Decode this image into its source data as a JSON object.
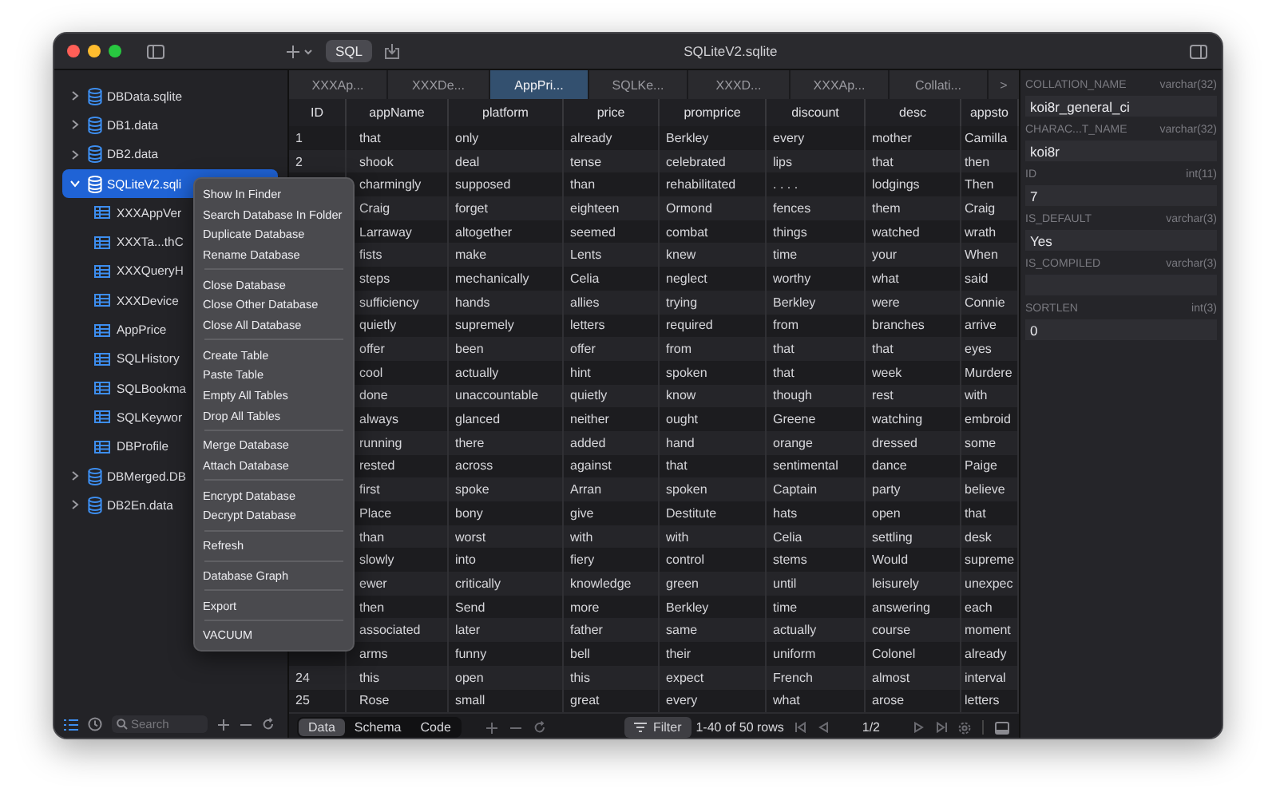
{
  "window": {
    "title": "SQLiteV2.sqlite"
  },
  "toolbar": {
    "sql_button": "SQL"
  },
  "sidebar": {
    "items": [
      {
        "name": "DBData.sqlite",
        "kind": "database",
        "expanded": false,
        "selected": false
      },
      {
        "name": "DB1.data",
        "kind": "database",
        "expanded": false,
        "selected": false
      },
      {
        "name": "DB2.data",
        "kind": "database",
        "expanded": false,
        "selected": false
      },
      {
        "name": "SQLiteV2.sqli",
        "kind": "database",
        "expanded": true,
        "selected": true,
        "children": [
          {
            "name": "XXXAppVer",
            "kind": "table",
            "selected": false
          },
          {
            "name": "XXXTa...thC",
            "kind": "table",
            "selected": false
          },
          {
            "name": "XXXQueryH",
            "kind": "table",
            "selected": false
          },
          {
            "name": "XXXDevice",
            "kind": "table",
            "selected": false
          },
          {
            "name": "AppPrice",
            "kind": "table",
            "selected": false
          },
          {
            "name": "SQLHistory",
            "kind": "table",
            "selected": false
          },
          {
            "name": "SQLBookma",
            "kind": "table",
            "selected": false
          },
          {
            "name": "SQLKeywor",
            "kind": "table",
            "selected": false
          },
          {
            "name": "DBProfile",
            "kind": "table",
            "selected": false
          }
        ]
      },
      {
        "name": "DBMerged.DB",
        "kind": "database",
        "expanded": false,
        "selected": false
      },
      {
        "name": "DB2En.data",
        "kind": "database",
        "expanded": false,
        "selected": false
      }
    ],
    "search": {
      "placeholder": "Search"
    }
  },
  "context_menu": [
    [
      "Show In Finder",
      "Search Database In Folder",
      "Duplicate Database",
      "Rename Database"
    ],
    [
      "Close Database",
      "Close Other Database",
      "Close All Database"
    ],
    [
      "Create Table",
      "Paste Table",
      "Empty All Tables",
      "Drop All Tables"
    ],
    [
      "Merge Database",
      "Attach Database"
    ],
    [
      "Encrypt Database",
      "Decrypt Database"
    ],
    [
      "Refresh"
    ],
    [
      "Database Graph"
    ],
    [
      "Export"
    ],
    [
      "VACUUM"
    ]
  ],
  "tabs": [
    {
      "label": "XXXAp...",
      "selected": false
    },
    {
      "label": "XXXDe...",
      "selected": false
    },
    {
      "label": "AppPri...",
      "selected": true
    },
    {
      "label": "SQLKe...",
      "selected": false
    },
    {
      "label": "XXXD...",
      "selected": false
    },
    {
      "label": "XXXAp...",
      "selected": false
    },
    {
      "label": "Collati...",
      "selected": false
    }
  ],
  "tabs_more": ">",
  "table": {
    "columns": [
      "ID",
      "appName",
      "platform",
      "price",
      "promprice",
      "discount",
      "desc",
      "appsto"
    ],
    "rows": [
      [
        "1",
        "that",
        "only",
        "already",
        "Berkley",
        "every",
        "mother",
        "Camilla"
      ],
      [
        "2",
        "shook",
        "deal",
        "tense",
        "celebrated",
        "lips",
        "that",
        "then"
      ],
      [
        "",
        "charmingly",
        "supposed",
        "than",
        "rehabilitated",
        ". . . .",
        "lodgings",
        "Then"
      ],
      [
        "",
        "Craig",
        "forget",
        "eighteen",
        "Ormond",
        "fences",
        "them",
        "Craig"
      ],
      [
        "",
        "Larraway",
        "altogether",
        "seemed",
        "combat",
        "things",
        "watched",
        "wrath"
      ],
      [
        "",
        "fists",
        "make",
        "Lents",
        "knew",
        "time",
        "your",
        "When"
      ],
      [
        "",
        "steps",
        "mechanically",
        "Celia",
        "neglect",
        "worthy",
        "what",
        "said"
      ],
      [
        "",
        "sufficiency",
        "hands",
        "allies",
        "trying",
        "Berkley",
        "were",
        "Connie"
      ],
      [
        "",
        "quietly",
        "supremely",
        "letters",
        "required",
        "from",
        "branches",
        "arrive"
      ],
      [
        "",
        "offer",
        "been",
        "offer",
        "from",
        "that",
        "that",
        "eyes"
      ],
      [
        "",
        "cool",
        "actually",
        "hint",
        "spoken",
        "that",
        "week",
        "Murdere"
      ],
      [
        "",
        "done",
        "unaccountable",
        "quietly",
        "know",
        "though",
        "rest",
        "with"
      ],
      [
        "",
        "always",
        "glanced",
        "neither",
        "ought",
        "Greene",
        "watching",
        "embroid"
      ],
      [
        "",
        "running",
        "there",
        "added",
        "hand",
        "orange",
        "dressed",
        "some"
      ],
      [
        "",
        "rested",
        "across",
        "against",
        "that",
        "sentimental",
        "dance",
        "Paige"
      ],
      [
        "",
        "first",
        "spoke",
        "Arran",
        "spoken",
        "Captain",
        "party",
        "believe"
      ],
      [
        "",
        "Place",
        "bony",
        "give",
        "Destitute",
        "hats",
        "open",
        "that"
      ],
      [
        "",
        "than",
        "worst",
        "with",
        "with",
        "Celia",
        "settling",
        "desk"
      ],
      [
        "",
        "slowly",
        "into",
        "fiery",
        "control",
        "stems",
        "Would",
        "supreme"
      ],
      [
        "",
        "ewer",
        "critically",
        "knowledge",
        "green",
        "until",
        "leisurely",
        "unexpec"
      ],
      [
        "",
        "then",
        "Send",
        "more",
        "Berkley",
        "time",
        "answering",
        "each"
      ],
      [
        "",
        "associated",
        "later",
        "father",
        "same",
        "actually",
        "course",
        "moment"
      ],
      [
        "",
        "arms",
        "funny",
        "bell",
        "their",
        "uniform",
        "Colonel",
        "already"
      ],
      [
        "24",
        "this",
        "open",
        "this",
        "expect",
        "French",
        "almost",
        "interval"
      ],
      [
        "25",
        "Rose",
        "small",
        "great",
        "every",
        "what",
        "arose",
        "letters"
      ]
    ]
  },
  "bottom_bar": {
    "views": [
      {
        "label": "Data",
        "selected": true
      },
      {
        "label": "Schema",
        "selected": false
      },
      {
        "label": "Code",
        "selected": false
      }
    ],
    "filter_button": "Filter",
    "row_info": "1-40 of 50 rows",
    "page": "1/2"
  },
  "details": [
    {
      "name": "COLLATION_NAME",
      "type": "varchar(32)",
      "value": "koi8r_general_ci"
    },
    {
      "name": "CHARAC...T_NAME",
      "type": "varchar(32)",
      "value": "koi8r"
    },
    {
      "name": "ID",
      "type": "int(11)",
      "value": "7"
    },
    {
      "name": "IS_DEFAULT",
      "type": "varchar(3)",
      "value": "Yes"
    },
    {
      "name": "IS_COMPILED",
      "type": "varchar(3)"
    },
    {
      "name": "SORTLEN",
      "type": "int(3)",
      "value": "0"
    }
  ]
}
